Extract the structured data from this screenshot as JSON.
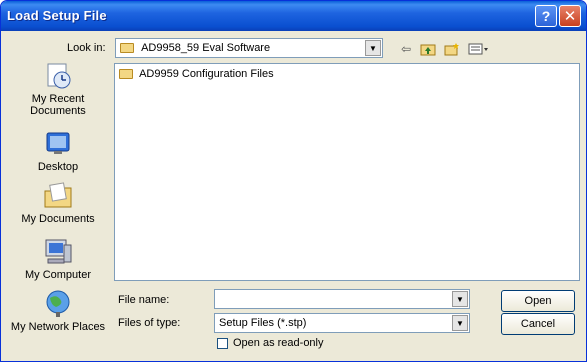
{
  "window": {
    "title": "Load Setup File"
  },
  "title_buttons": {
    "help": "?",
    "close": "✕"
  },
  "lookin": {
    "label": "Look in:",
    "value": "AD9958_59 Eval Software"
  },
  "places": [
    {
      "label": "My Recent Documents",
      "icon": "recent-documents-icon"
    },
    {
      "label": "Desktop",
      "icon": "desktop-icon"
    },
    {
      "label": "My Documents",
      "icon": "my-documents-icon"
    },
    {
      "label": "My Computer",
      "icon": "my-computer-icon"
    },
    {
      "label": "My Network Places",
      "icon": "network-places-icon"
    }
  ],
  "files": [
    {
      "name": "AD9959 Configuration Files",
      "icon": "folder-icon"
    }
  ],
  "filename": {
    "label": "File name:",
    "value": ""
  },
  "filetype": {
    "label": "Files of type:",
    "value": "Setup Files (*.stp)"
  },
  "readonly": {
    "label": "Open as read-only",
    "checked": false
  },
  "buttons": {
    "open": "Open",
    "cancel": "Cancel"
  }
}
